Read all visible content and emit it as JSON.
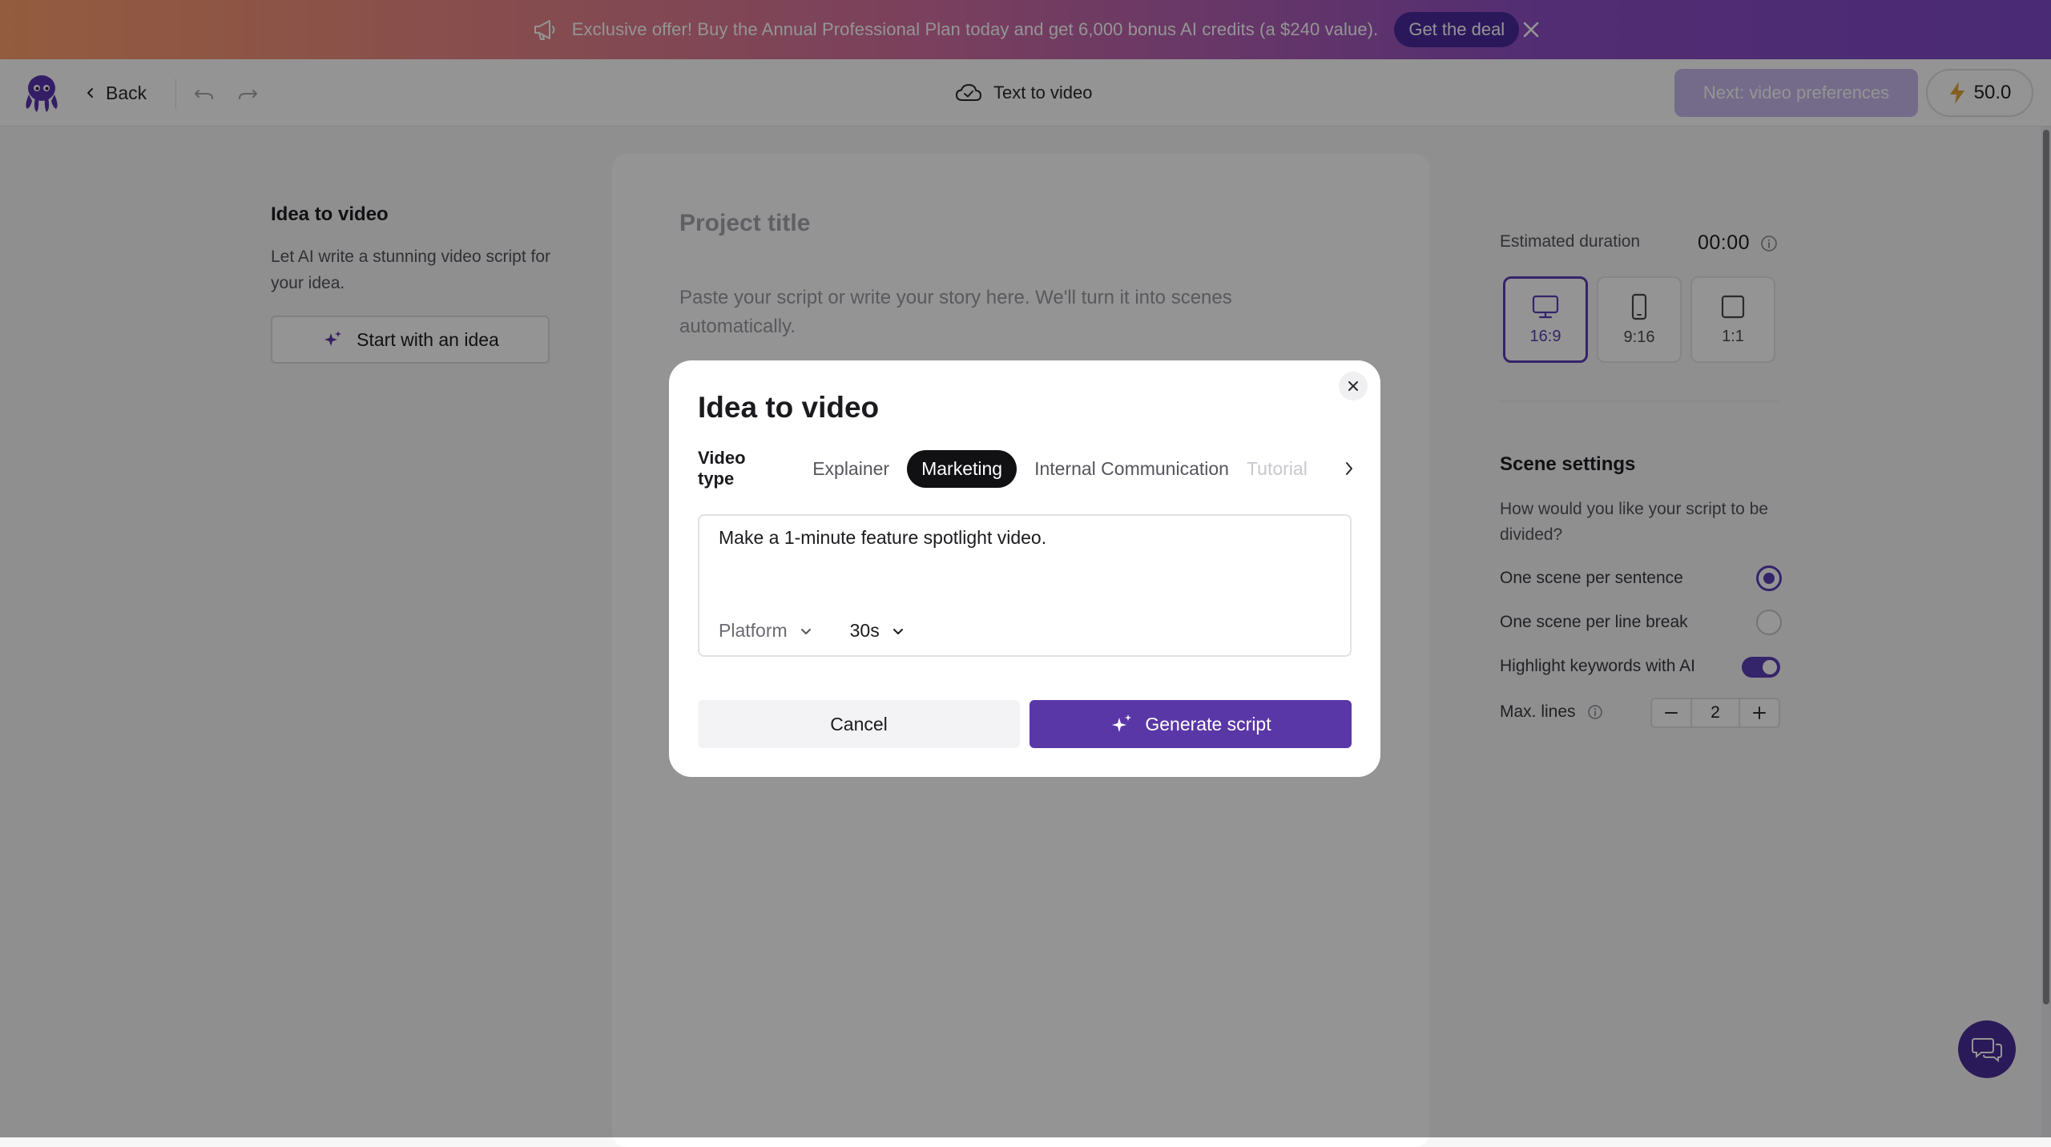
{
  "promo": {
    "text": "Exclusive offer! Buy the Annual Professional Plan today and get 6,000 bonus AI credits (a $240 value).",
    "cta": "Get the deal"
  },
  "topbar": {
    "back_label": "Back",
    "mode_label": "Text to video",
    "next_label": "Next: video preferences",
    "credits": "50.0"
  },
  "left_panel": {
    "title": "Idea to video",
    "description": "Let AI write a stunning video script for your idea.",
    "start_button": "Start with an idea"
  },
  "editor": {
    "title_placeholder": "Project title",
    "body_placeholder": "Paste your script or write your story here. We'll turn it into scenes automatically."
  },
  "right_panel": {
    "estimated_label": "Estimated duration",
    "estimated_value": "00:00",
    "ratios": [
      {
        "label": "16:9",
        "selected": true
      },
      {
        "label": "9:16",
        "selected": false
      },
      {
        "label": "1:1",
        "selected": false
      }
    ],
    "scene_title": "Scene settings",
    "scene_desc": "How would you like your script to be divided?",
    "option_sentence": "One scene per sentence",
    "option_line": "One scene per line break",
    "highlight_label": "Highlight keywords with AI",
    "highlight_on": true,
    "max_lines_label": "Max. lines",
    "max_lines_value": "2"
  },
  "modal": {
    "title": "Idea to video",
    "video_type_label": "Video type",
    "tabs": [
      "Explainer",
      "Marketing",
      "Internal Communication",
      "Tutorial"
    ],
    "selected_tab": "Marketing",
    "prompt_text": "Make a 1-minute feature spotlight video.",
    "platform_label": "Platform",
    "duration_value": "30s",
    "cancel_label": "Cancel",
    "generate_label": "Generate script"
  },
  "colors": {
    "accent": "#5a37a7",
    "dark_pill": "#111114",
    "banner_start": "#ff9f6b",
    "banner_end": "#7f49c9"
  }
}
